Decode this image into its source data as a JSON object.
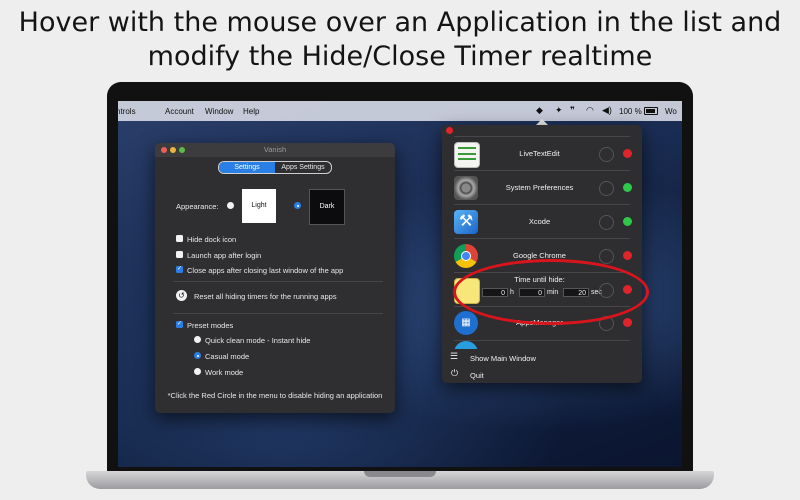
{
  "headline": {
    "line1": "Hover with the mouse over an Application in the list and",
    "line2": "modify the Hide/Close Timer realtime"
  },
  "menubar": {
    "items": [
      "ntrols",
      "Account",
      "Window",
      "Help"
    ],
    "battery_percent": "100 %",
    "trailing": "Wo"
  },
  "window": {
    "title": "Vanish",
    "tabs": [
      "Settings",
      "Apps Settings"
    ],
    "active_tab": 0,
    "appearance_label": "Appearance:",
    "appearance_options": [
      "Light",
      "Dark"
    ],
    "appearance_selected": "Dark",
    "checkboxes": [
      {
        "label": "Hide dock icon",
        "checked": false
      },
      {
        "label": "Launch app after login",
        "checked": false
      },
      {
        "label": "Close apps after closing last window of the app",
        "checked": true
      }
    ],
    "reset_label": "Reset all hiding timers for the running apps",
    "preset_label": "Preset modes",
    "preset_checked": true,
    "modes": [
      {
        "label": "Quick clean mode - Instant hide",
        "selected": false
      },
      {
        "label": "Casual mode",
        "selected": true
      },
      {
        "label": "Work mode",
        "selected": false
      }
    ],
    "footnote": "*Click the Red Circle in the menu to disable hiding an application"
  },
  "panel": {
    "apps": [
      {
        "name": "LiveTextEdit",
        "icon": "livetextedit-icon",
        "status": "red"
      },
      {
        "name": "System Preferences",
        "icon": "system-preferences-icon",
        "status": "green"
      },
      {
        "name": "Xcode",
        "icon": "xcode-icon",
        "status": "green"
      },
      {
        "name": "Google Chrome",
        "icon": "chrome-icon",
        "status": "red"
      }
    ],
    "timer": {
      "title": "Time until hide:",
      "hours": "0",
      "hours_unit": "h",
      "minutes": "0",
      "minutes_unit": "min",
      "seconds": "20",
      "seconds_unit": "sec",
      "status": "red"
    },
    "apps_after": [
      {
        "name": "AppsManager",
        "icon": "appsmanager-icon",
        "status": "red"
      }
    ],
    "show_main_window": "Show Main Window",
    "quit": "Quit"
  },
  "colors": {
    "accent": "#2a7fe6",
    "status_red": "#e0242c",
    "status_green": "#2fc84a",
    "highlight": "#d8141c"
  }
}
